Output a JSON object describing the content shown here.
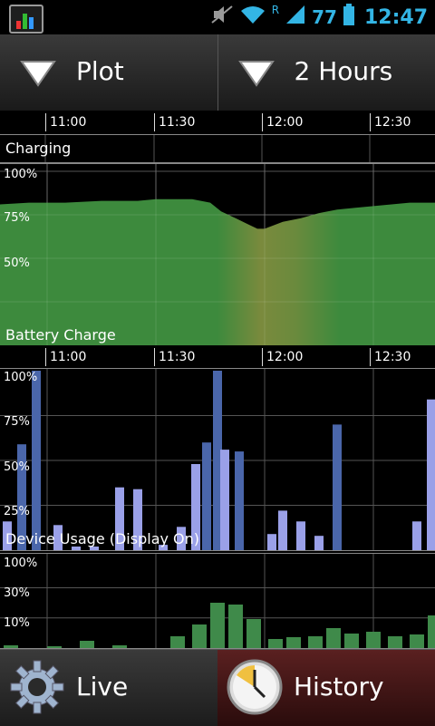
{
  "status_bar": {
    "battery_level": "77",
    "clock": "12:47",
    "icons": [
      "app-icon",
      "mute-icon",
      "wifi-icon",
      "roaming-icon",
      "signal-icon"
    ],
    "accent_color": "#33b5e5"
  },
  "toolbar": {
    "plot_label": "Plot",
    "range_label": "2 Hours"
  },
  "time_axis": {
    "ticks": [
      "11:00",
      "11:30",
      "12:00",
      "12:30"
    ]
  },
  "charging": {
    "label": "Charging"
  },
  "battery_chart": {
    "label": "Battery Charge",
    "y_labels": [
      "100%",
      "75%",
      "50%"
    ]
  },
  "usage_chart": {
    "label": "Device Usage (Display On)",
    "y_labels": [
      "100%",
      "75%",
      "50%",
      "25%"
    ]
  },
  "network_chart": {
    "y_labels": [
      "100%",
      "30%",
      "10%"
    ]
  },
  "bottom": {
    "live_label": "Live",
    "history_label": "History"
  },
  "chart_data": [
    {
      "type": "area",
      "title": "Battery Charge",
      "x": [
        "10:47",
        "10:55",
        "11:05",
        "11:15",
        "11:25",
        "11:30",
        "11:35",
        "11:40",
        "11:45",
        "11:48",
        "11:52",
        "11:55",
        "11:58",
        "12:00",
        "12:05",
        "12:10",
        "12:15",
        "12:20",
        "12:25",
        "12:30",
        "12:40",
        "12:47"
      ],
      "values": [
        81,
        82,
        82,
        83,
        83,
        84,
        84,
        84,
        82,
        77,
        73,
        70,
        67,
        67,
        71,
        73,
        76,
        78,
        79,
        80,
        82,
        82
      ],
      "ylim": [
        0,
        100
      ]
    },
    {
      "type": "bar",
      "title": "Device Usage (Display On)",
      "x": [
        "10:49",
        "10:53",
        "10:57",
        "11:03",
        "11:08",
        "11:13",
        "11:20",
        "11:25",
        "11:32",
        "11:37",
        "11:41",
        "11:44",
        "11:47",
        "11:49",
        "11:53",
        "11:57",
        "12:02",
        "12:05",
        "12:10",
        "12:15",
        "12:20",
        "12:42",
        "12:46"
      ],
      "values": [
        16,
        59,
        100,
        14,
        2,
        2,
        35,
        34,
        3,
        13,
        48,
        60,
        100,
        56,
        55,
        0,
        9,
        22,
        16,
        8,
        70,
        16,
        84
      ],
      "ylim": [
        0,
        100
      ]
    },
    {
      "type": "bar",
      "title": "",
      "x": [
        "10:50",
        "11:02",
        "11:11",
        "11:20",
        "11:36",
        "11:42",
        "11:47",
        "11:52",
        "11:57",
        "12:03",
        "12:08",
        "12:14",
        "12:19",
        "12:24",
        "12:30",
        "12:36",
        "12:42",
        "12:47"
      ],
      "values": [
        3,
        2,
        8,
        3,
        13,
        26,
        50,
        48,
        32,
        10,
        12,
        13,
        22,
        16,
        18,
        13,
        15,
        36
      ],
      "ylim": [
        0,
        100
      ]
    }
  ]
}
